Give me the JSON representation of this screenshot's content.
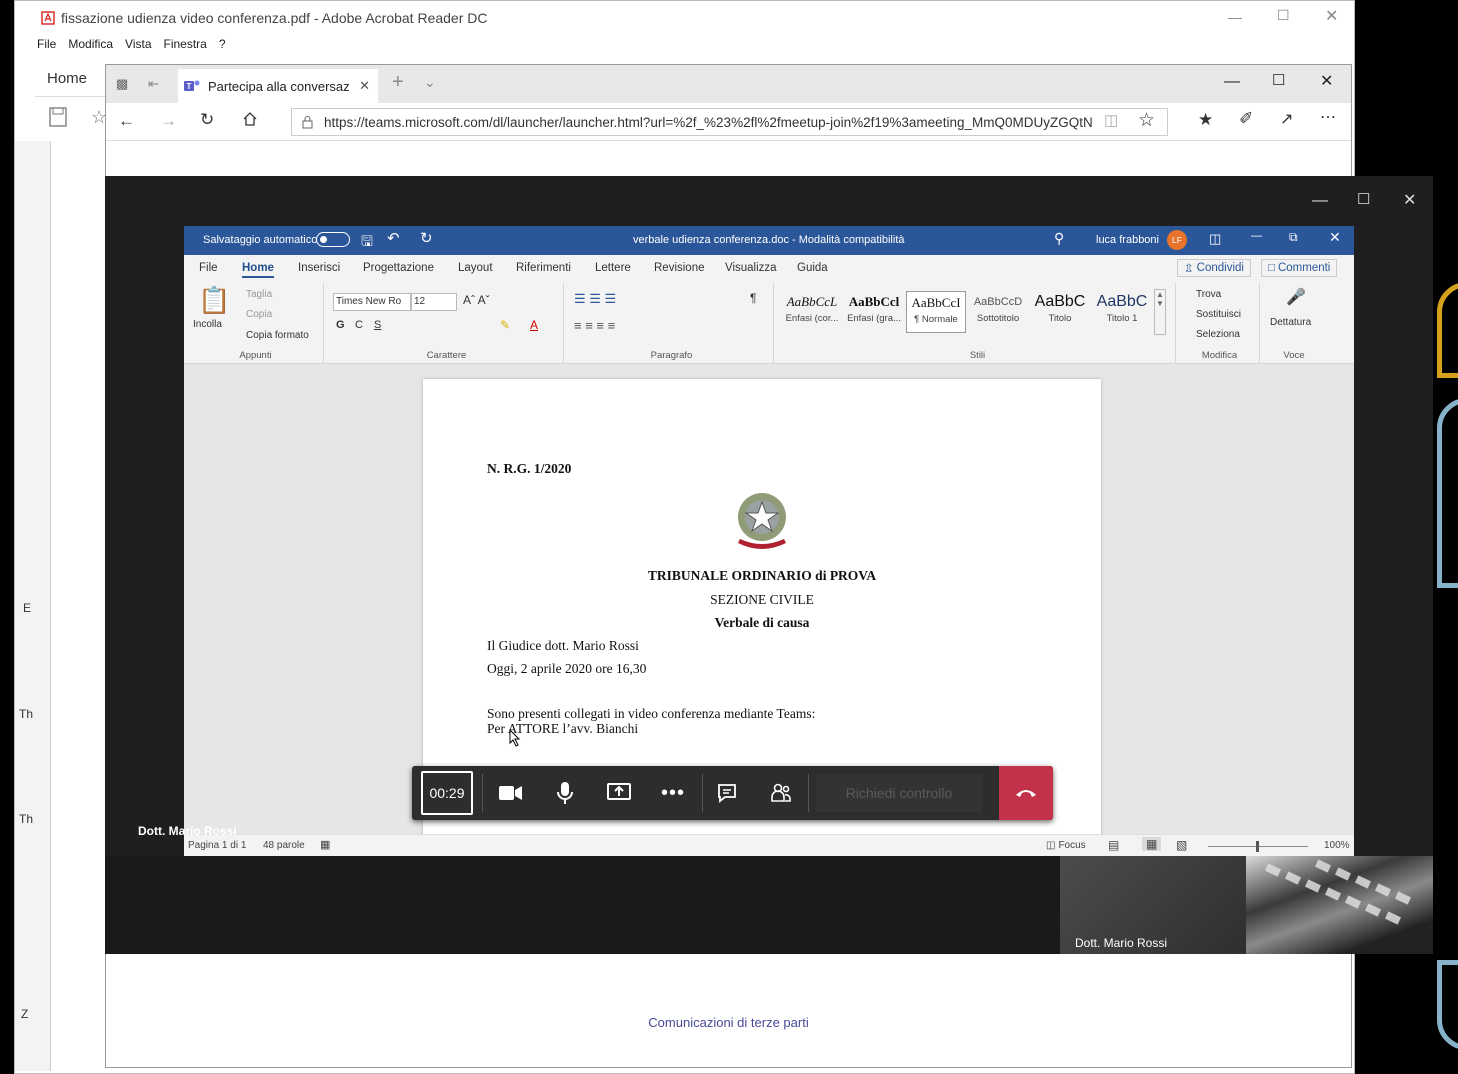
{
  "acrobat": {
    "title": "fissazione udienza video conferenza.pdf - Adobe Acrobat Reader DC",
    "menu": [
      "File",
      "Modifica",
      "Vista",
      "Finestra",
      "?"
    ],
    "home_tab": "Home",
    "left_letters": [
      "E",
      "Th",
      "Th",
      "Z"
    ]
  },
  "edge": {
    "tab_title": "Partecipa alla conversaz",
    "url": "https://teams.microsoft.com/dl/launcher/launcher.html?url=%2f_%23%2fl%2fmeetup-join%2f19%3ameeting_MmQ0MDUyZGQtN",
    "footer_link": "Comunicazioni di terze parti"
  },
  "word": {
    "autosave_label": "Salvataggio automatico",
    "doc_title": "verbale udienza conferenza.doc - Modalità compatibilità",
    "user_name": "luca frabboni",
    "user_initials": "LF",
    "tabs": [
      "File",
      "Home",
      "Inserisci",
      "Progettazione",
      "Layout",
      "Riferimenti",
      "Lettere",
      "Revisione",
      "Visualizza",
      "Guida"
    ],
    "active_tab": "Home",
    "share_label": "Condividi",
    "comments_label": "Commenti",
    "clipboard": {
      "paste": "Incolla",
      "cut": "Taglia",
      "copy": "Copia",
      "format_painter": "Copia formato",
      "group": "Appunti"
    },
    "font": {
      "name": "Times New Ro",
      "size": "12",
      "group": "Carattere",
      "bold": "G",
      "italic": "C",
      "underline": "S"
    },
    "paragraph_group": "Paragrafo",
    "styles": [
      {
        "preview": "AaBbCcL",
        "name": "Enfasi (cor..."
      },
      {
        "preview": "AaBbCcl",
        "name": "Enfasi (gra..."
      },
      {
        "preview": "AaBbCcI",
        "name": "¶ Normale"
      },
      {
        "preview": "AaBbCcD",
        "name": "Sottotitolo"
      },
      {
        "preview": "AaBbC",
        "name": "Titolo"
      },
      {
        "preview": "AaBbC",
        "name": "Titolo 1"
      }
    ],
    "styles_group": "Stili",
    "editing": {
      "find": "Trova",
      "replace": "Sostituisci",
      "select": "Seleziona",
      "group": "Modifica"
    },
    "voice": {
      "dictate": "Dettatura",
      "group": "Voce"
    },
    "document": {
      "rg": "N. R.G. 1/2020",
      "court": "TRIBUNALE ORDINARIO di PROVA",
      "section": "SEZIONE CIVILE",
      "doc_kind": "Verbale di causa",
      "judge": "Il Giudice dott. Mario Rossi",
      "date": "Oggi, 2 aprile 2020 ore 16,30",
      "present": "Sono presenti collegati in video conferenza mediante Teams:",
      "actor": "Per ATTORE l’avv. Bianchi"
    },
    "status": {
      "page": "Pagina 1 di 1",
      "words": "48 parole",
      "focus": "Focus",
      "zoom": "100%"
    }
  },
  "teams": {
    "timer": "00:29",
    "request_control": "Richiedi controllo",
    "presenter_label": "Dott. Mario Rossi",
    "self_label": "Dott. Mario Rossi"
  },
  "colors": {
    "word_blue": "#2b579a",
    "hangup_red": "#c4314b",
    "teams_bar": "#2d2d2d"
  }
}
